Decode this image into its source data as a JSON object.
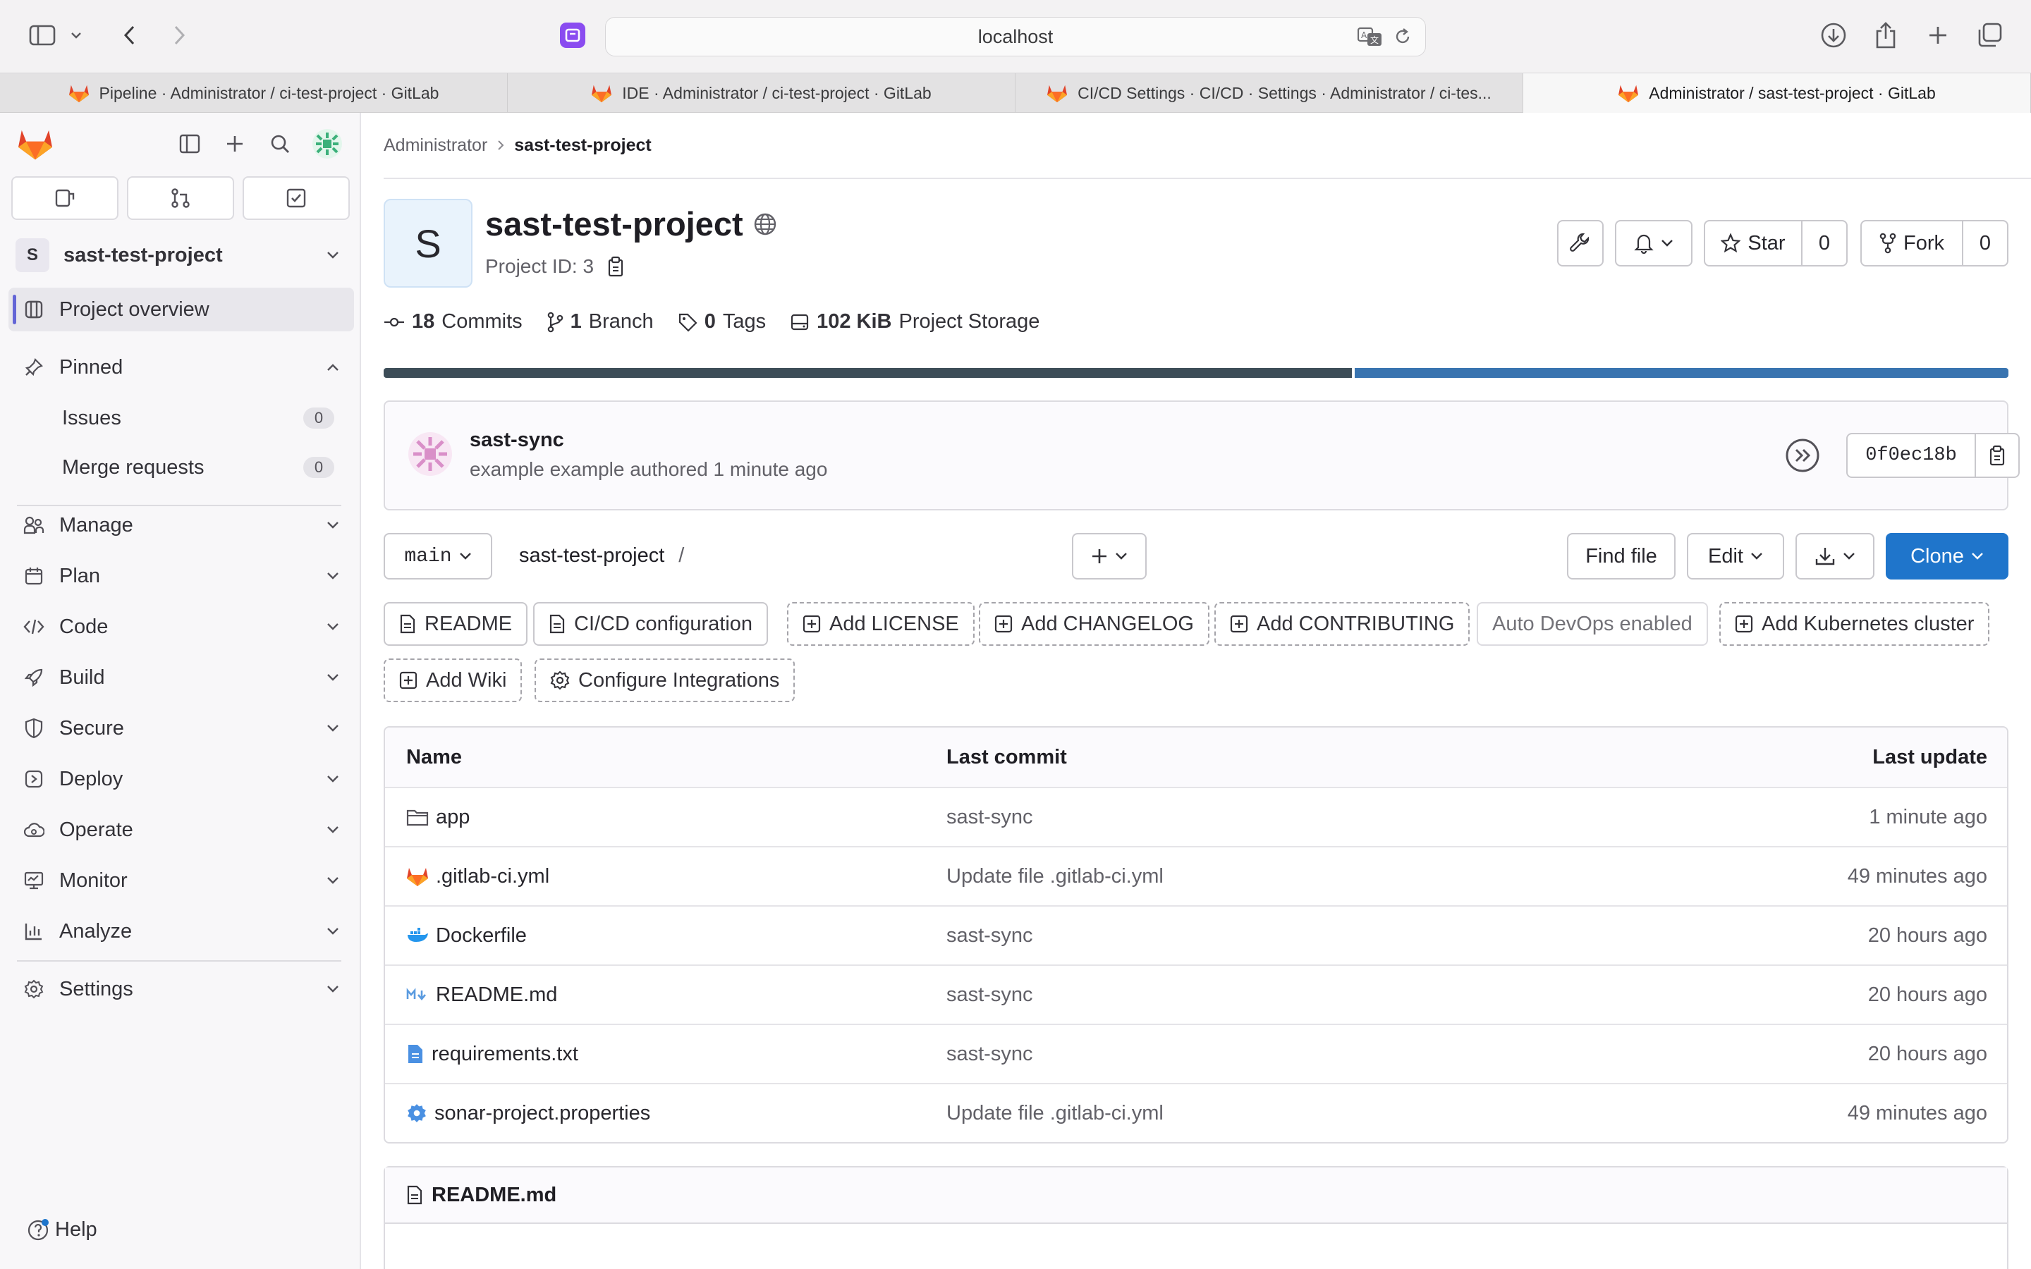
{
  "browser": {
    "url": "localhost",
    "tabs": [
      {
        "label": "Pipeline · Administrator / ci-test-project · GitLab",
        "active": false
      },
      {
        "label": "IDE · Administrator / ci-test-project · GitLab",
        "active": false
      },
      {
        "label": "CI/CD Settings · CI/CD · Settings · Administrator / ci-tes...",
        "active": false
      },
      {
        "label": "Administrator / sast-test-project · GitLab",
        "active": true
      }
    ]
  },
  "sidebar": {
    "project_initial": "S",
    "project_name": "sast-test-project",
    "overview": "Project overview",
    "pinned": "Pinned",
    "pinned_items": [
      {
        "label": "Issues",
        "count": "0"
      },
      {
        "label": "Merge requests",
        "count": "0"
      }
    ],
    "sections": [
      "Manage",
      "Plan",
      "Code",
      "Build",
      "Secure",
      "Deploy",
      "Operate",
      "Monitor",
      "Analyze"
    ],
    "settings": "Settings",
    "help": "Help"
  },
  "breadcrumb": {
    "parent": "Administrator",
    "current": "sast-test-project"
  },
  "project": {
    "avatar_letter": "S",
    "name": "sast-test-project",
    "project_id": "Project ID: 3",
    "star_label": "Star",
    "star_count": "0",
    "fork_label": "Fork",
    "fork_count": "0",
    "stats": {
      "commits_num": "18",
      "commits_label": "Commits",
      "branches_num": "1",
      "branches_label": "Branch",
      "tags_num": "0",
      "tags_label": "Tags",
      "storage_num": "102 KiB",
      "storage_label": "Project Storage"
    },
    "language_bar_fraction": 0.596,
    "language_colors": [
      "#3d4d58",
      "#3974b0"
    ]
  },
  "commit": {
    "title": "sast-sync",
    "meta": "example example authored 1 minute ago",
    "sha": "0f0ec18b"
  },
  "repo_bar": {
    "branch": "main",
    "path": "sast-test-project",
    "path_sep": "/",
    "find_file": "Find file",
    "edit": "Edit",
    "clone": "Clone"
  },
  "shortcuts": [
    {
      "label": "README",
      "style": "solid"
    },
    {
      "label": "CI/CD configuration",
      "style": "solid"
    },
    {
      "label": "Add LICENSE",
      "style": "dashed"
    },
    {
      "label": "Add CHANGELOG",
      "style": "dashed"
    },
    {
      "label": "Add CONTRIBUTING",
      "style": "dashed"
    },
    {
      "label": "Auto DevOps enabled",
      "style": "muted"
    },
    {
      "label": "Add Kubernetes cluster",
      "style": "dashed"
    },
    {
      "label": "Add Wiki",
      "style": "dashed"
    },
    {
      "label": "Configure Integrations",
      "style": "dashed"
    }
  ],
  "table": {
    "headers": {
      "name": "Name",
      "last_commit": "Last commit",
      "last_update": "Last update"
    },
    "rows": [
      {
        "name": "app",
        "icon": "folder-icon",
        "commit": "sast-sync",
        "updated": "1 minute ago"
      },
      {
        "name": ".gitlab-ci.yml",
        "icon": "gitlab-icon",
        "commit": "Update file .gitlab-ci.yml",
        "updated": "49 minutes ago"
      },
      {
        "name": "Dockerfile",
        "icon": "docker-icon",
        "commit": "sast-sync",
        "updated": "20 hours ago"
      },
      {
        "name": "README.md",
        "icon": "markdown-icon",
        "commit": "sast-sync",
        "updated": "20 hours ago"
      },
      {
        "name": "requirements.txt",
        "icon": "text-file-icon",
        "commit": "sast-sync",
        "updated": "20 hours ago"
      },
      {
        "name": "sonar-project.properties",
        "icon": "settings-file-icon",
        "commit": "Update file .gitlab-ci.yml",
        "updated": "49 minutes ago"
      }
    ]
  },
  "readme": {
    "title": "README.md"
  }
}
